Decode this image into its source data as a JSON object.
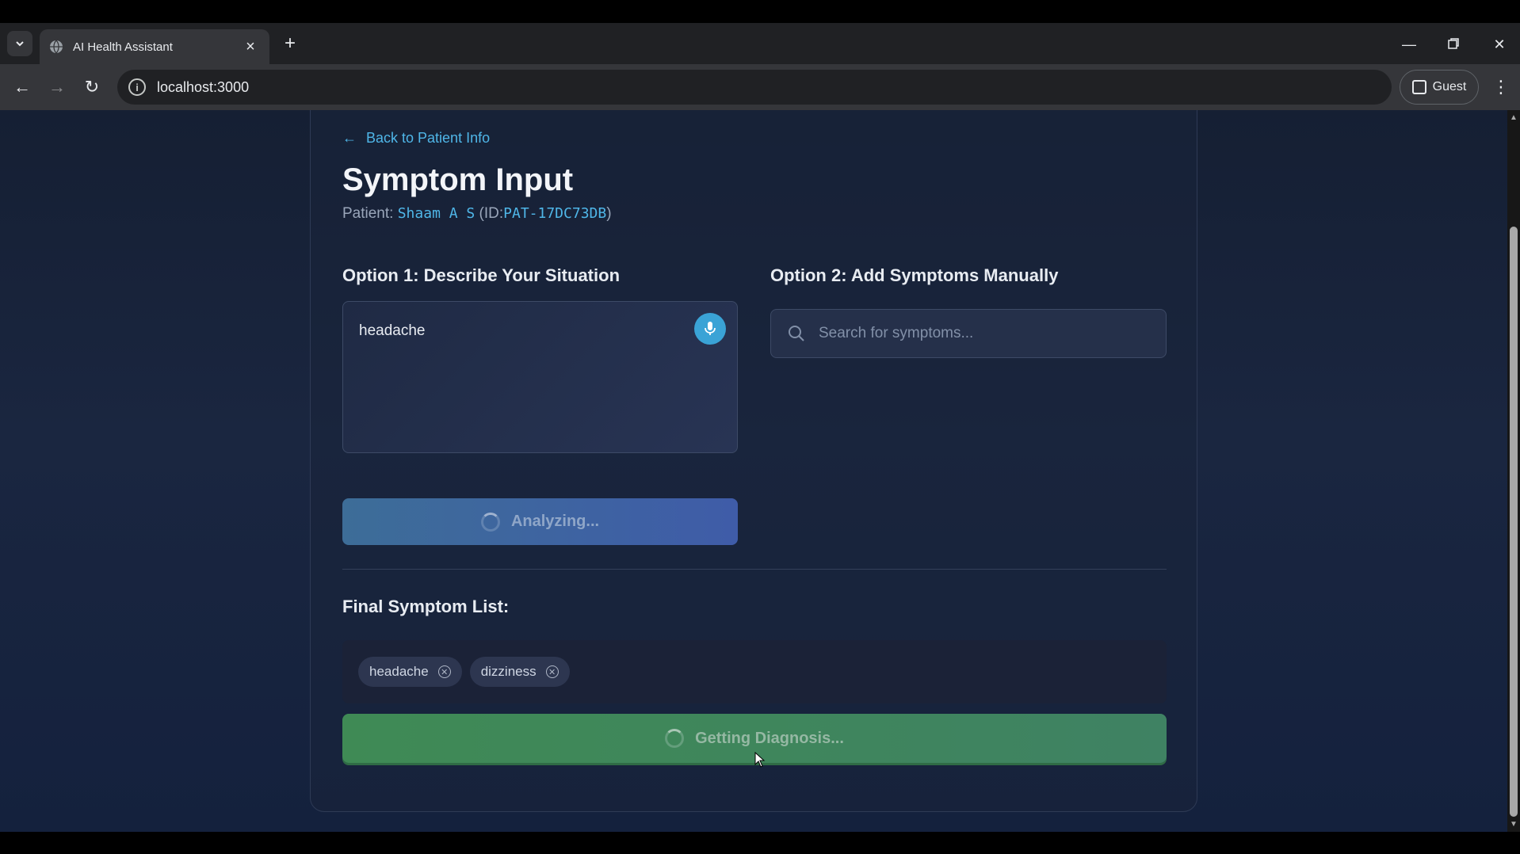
{
  "browser": {
    "tab_title": "AI Health Assistant",
    "url": "localhost:3000",
    "profile_label": "Guest",
    "tab_list_icon": "chevron-down-icon",
    "new_tab_icon": "plus-icon"
  },
  "page": {
    "back_link": "Back to Patient Info",
    "title": "Symptom Input",
    "patient_label": "Patient:",
    "patient_name": "Shaam A S",
    "id_prefix": "(ID:",
    "patient_id": "PAT-17DC73DB",
    "id_suffix": ")"
  },
  "option1": {
    "heading": "Option 1: Describe Your Situation",
    "text_value": "headache",
    "analyze_label": "Analyzing..."
  },
  "option2": {
    "heading": "Option 2: Add Symptoms Manually",
    "search_placeholder": "Search for symptoms..."
  },
  "final": {
    "heading": "Final Symptom List:",
    "symptoms": [
      "headache",
      "dizziness"
    ],
    "diagnosis_label": "Getting Diagnosis..."
  },
  "colors": {
    "accent": "#4fb6e8",
    "analyze_button": "#3f5ca8",
    "diagnosis_button": "#3f8a55"
  }
}
